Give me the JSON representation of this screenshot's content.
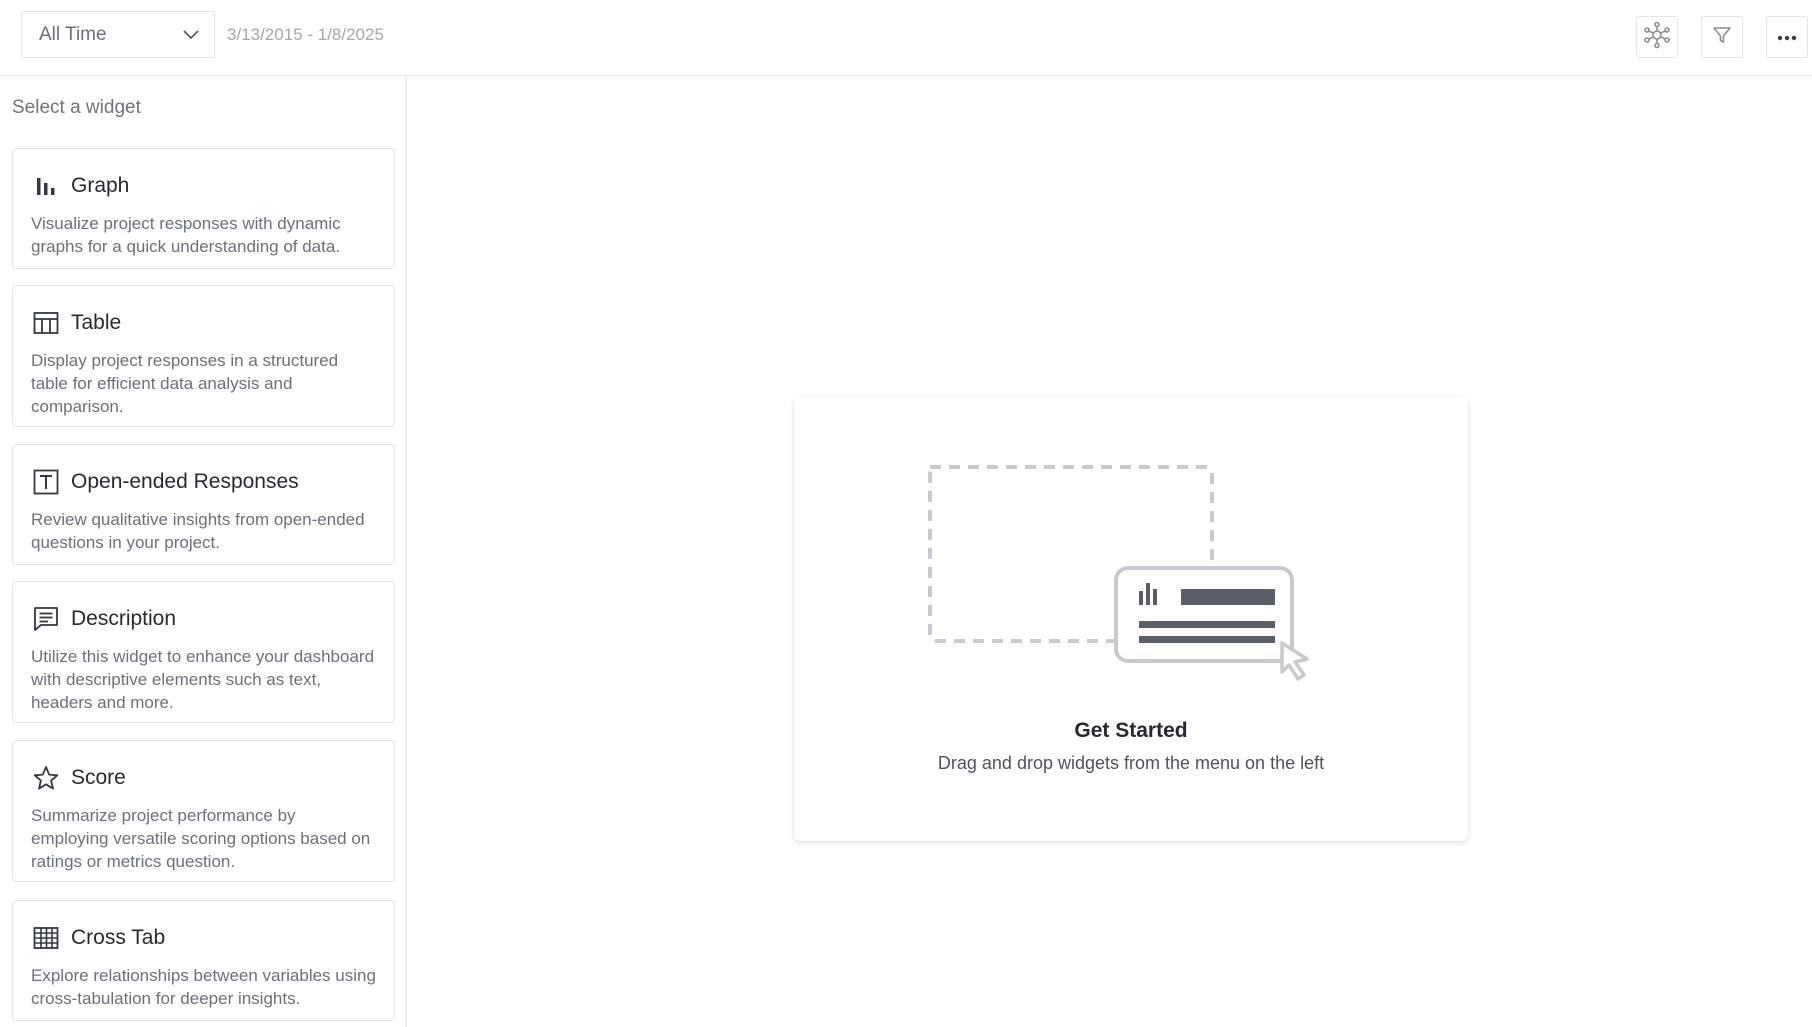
{
  "header": {
    "range_select": {
      "value": "All Time",
      "icon": "chevron-down-icon"
    },
    "date_range": "3/13/2015 - 1/8/2025",
    "actions": [
      {
        "name": "network-icon"
      },
      {
        "name": "filter-icon"
      },
      {
        "name": "more-icon"
      }
    ]
  },
  "sidebar": {
    "title": "Select a widget",
    "widgets": [
      {
        "icon": "bar-chart-icon",
        "name": "Graph",
        "description": "Visualize project responses with dynamic graphs for a quick understanding of data."
      },
      {
        "icon": "table-icon",
        "name": "Table",
        "description": "Display project responses in a structured table for efficient data analysis and comparison."
      },
      {
        "icon": "text-box-icon",
        "name": "Open-ended Responses",
        "description": "Review qualitative insights from open-ended questions in your project."
      },
      {
        "icon": "comment-lines-icon",
        "name": "Description",
        "description": "Utilize this widget to enhance your dashboard with descriptive elements such as text, headers and more."
      },
      {
        "icon": "star-outline-icon",
        "name": "Score",
        "description": "Summarize project performance by employing versatile scoring options based on ratings or metrics question."
      },
      {
        "icon": "grid-table-icon",
        "name": "Cross Tab",
        "description": "Explore relationships between variables using cross-tabulation for deeper insights."
      }
    ]
  },
  "main": {
    "get_started": {
      "title": "Get Started",
      "subtitle": "Drag and drop widgets from the menu on the left",
      "illustration": "drag-widget-illustration"
    }
  },
  "colors": {
    "border": "#e3e4e7",
    "icon_dark": "#333842",
    "illustration_gray": "#5a5e66",
    "illustration_light": "#c8cacf"
  }
}
